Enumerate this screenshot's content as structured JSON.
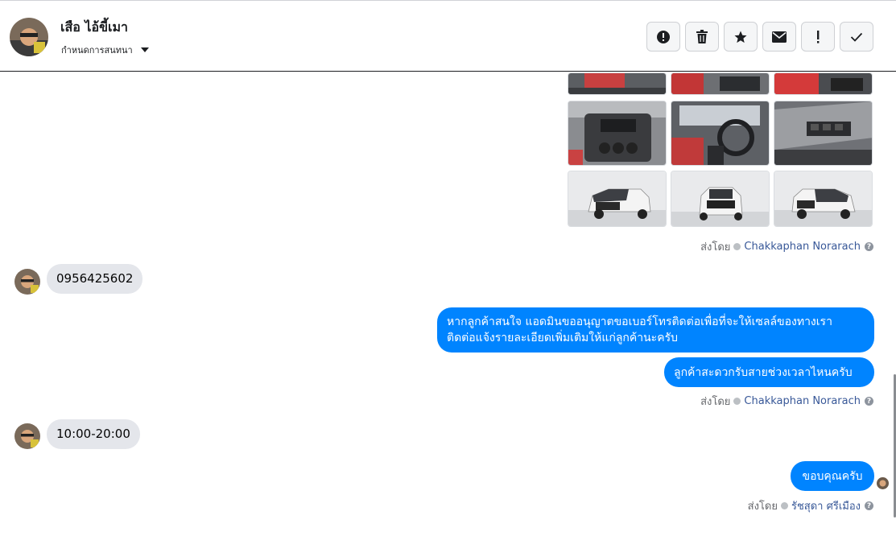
{
  "header": {
    "contact_name": "เสือ ไอ้ขี้เมา",
    "convo_menu_label": "กำหนดการสนทนา"
  },
  "toolbar": {
    "icons": [
      "alert-circle-icon",
      "trash-icon",
      "star-icon",
      "mail-icon",
      "exclamation-icon",
      "check-icon"
    ]
  },
  "messages": {
    "photos_sent_by_prefix": "ส่งโดย",
    "photos_sent_by_name": "Chakkaphan Norarach",
    "incoming_phone": "0956425602",
    "outgoing_ask_line1": "หากลูกค้าสนใจ แอดมินขออนุญาตขอเบอร์โทรติดต่อเพื่อที่จะให้เซลล์ของทางเรา",
    "outgoing_ask_line2": "ติดต่อแจ้งรายละเอียดเพิ่มเติมให้แก่ลูกค้านะครับ",
    "outgoing_time_question": "ลูกค้าสะดวกรับสายช่วงเวลาไหนครับ",
    "second_sent_by_prefix": "ส่งโดย",
    "second_sent_by_name": "Chakkaphan Norarach",
    "incoming_time": "10:00-20:00",
    "outgoing_thanks": "ขอบคุณครับ",
    "third_sent_by_prefix": "ส่งโดย",
    "third_sent_by_name": "รัชสุดา ศรีเมือง"
  },
  "colors": {
    "outgoing_bubble": "#0084ff",
    "incoming_bubble": "#e4e6eb",
    "link_name": "#385898"
  }
}
